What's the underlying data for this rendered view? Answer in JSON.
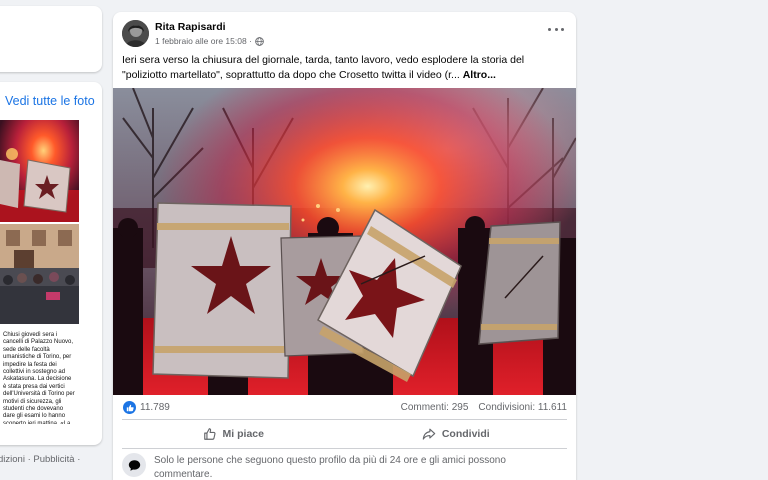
{
  "left_column": {
    "see_all_photos_label": "Vedi tutte le foto",
    "thumbnail_caption": "Chiusi giovedì sera i cancelli di Palazzo Nuovo, sede delle facoltà umanistiche di Torino, per impedire la festa dei collettivi in sostegno ad Askatasuna. La decisione è stata presa dai vertici dell'Università di Torino per motivi di sicurezza, gli studenti che dovevano dare gli esami lo hanno scoperto ieri mattina. «La questione non riguarda una festa ma il ruolo dell'università come istituzione",
    "footer_text": "dizioni · Pubblicità ·"
  },
  "post": {
    "author": "Rita Rapisardi",
    "timestamp": "1 febbraio alle ore 15:08 ·",
    "privacy_icon": "globe-icon",
    "body_text": "Ieri sera verso la chiusura del giornale, tarda, tanto lavoro, vedo esplodere la storia del \"poliziotto martellato\", soprattutto da dopo che Crosetto twitta il video (r...",
    "see_more_label": "Altro...",
    "like_count": "11.789",
    "comments_count": "Commenti: 295",
    "shares_count": "Condivisioni: 11.611",
    "like_button_label": "Mi piace",
    "share_button_label": "Condividi",
    "comment_restriction_text": "Solo le persone che seguono questo profilo da più di 24 ore e gli amici possono commentare."
  },
  "colors": {
    "accent": "#1b74e4",
    "secondary_text": "#65676b",
    "background": "#f0f2f5"
  }
}
